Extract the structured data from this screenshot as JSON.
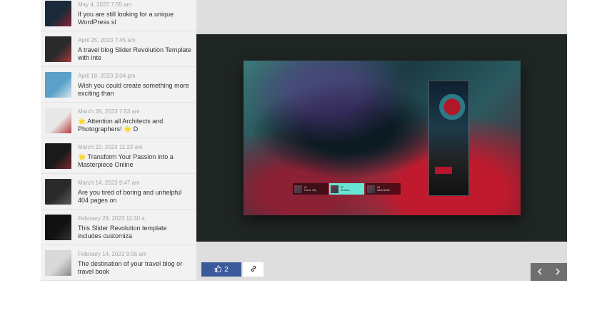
{
  "posts": [
    {
      "date": "May 4, 2023 7:55 am",
      "title": "If you are still looking for a unique WordPress sl",
      "thumb_colors": [
        "#1b2a3a",
        "#8a2432"
      ]
    },
    {
      "date": "April 25, 2023 7:45 am",
      "title": "A travel blog Slider Revolution Template with inte",
      "thumb_colors": [
        "#2a2a2a",
        "#a33a3a"
      ]
    },
    {
      "date": "April 18, 2023 3:04 pm",
      "title": "Wish you could create something more exciting than",
      "thumb_colors": [
        "#5aa0c8",
        "#d8e4ea"
      ]
    },
    {
      "date": "March 28, 2023 7:53 am",
      "title": "🌟 Attention all Architects and Photographers! 🌟 D",
      "thumb_colors": [
        "#e8e8e8",
        "#b4383a"
      ]
    },
    {
      "date": "March 22, 2023 11:23 am",
      "title": "🌟 Transform Your Passion into a Masterpiece Online",
      "thumb_colors": [
        "#1a1a1a",
        "#7a2a30"
      ]
    },
    {
      "date": "March 14, 2023 9:47 am",
      "title": "Are you tired of boring and unhelpful 404 pages on",
      "thumb_colors": [
        "#2a2a2a",
        "#5a5a5a"
      ]
    },
    {
      "date": "February 28, 2023 11:30 a",
      "title": "This Slider Revolution template includes customiza",
      "thumb_colors": [
        "#111111",
        "#333333"
      ]
    },
    {
      "date": "February 14, 2023 9:06 am",
      "title": "The destination of your travel blog or travel book",
      "thumb_colors": [
        "#d8d8d8",
        "#8a8a8a"
      ]
    }
  ],
  "actions": {
    "like_count": "2"
  },
  "slider_nav": [
    {
      "num": "01",
      "label": "Future City"
    },
    {
      "num": "02",
      "label": "AI Brain"
    },
    {
      "num": "03",
      "label": "Wine Bottle"
    }
  ],
  "colors": {
    "like_button": "#3b5a9b",
    "nav_active": "#67e6d4",
    "arrow_bg": "#6f6f6f"
  },
  "icons": {
    "like": "thumbs-up-icon",
    "link": "link-icon",
    "prev": "chevron-left-icon",
    "next": "chevron-right-icon"
  }
}
